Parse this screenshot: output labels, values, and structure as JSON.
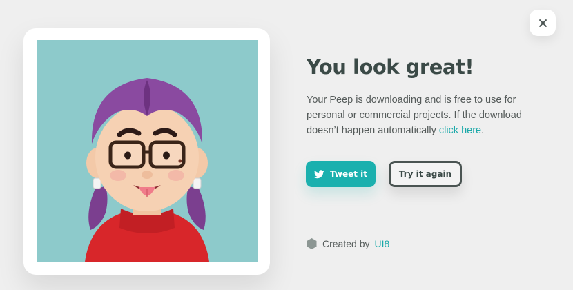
{
  "dialog": {
    "close_label": "×",
    "title": "You look great!",
    "description_prefix": "Your Peep is downloading and is free to use for personal or commercial projects. If the download doesn’t happen automatically ",
    "description_link": "click here",
    "description_suffix": ".",
    "tweet_button": "Tweet it",
    "retry_button": "Try it again",
    "credit_prefix": "Created by",
    "credit_brand": "UI8"
  },
  "colors": {
    "accent": "#1ab0ae",
    "avatar_background": "#8dcacb",
    "title": "#3b4a47"
  },
  "icons": {
    "close": "close-icon",
    "tweet": "twitter-bird-icon",
    "credit": "hexagon-logo-icon"
  }
}
